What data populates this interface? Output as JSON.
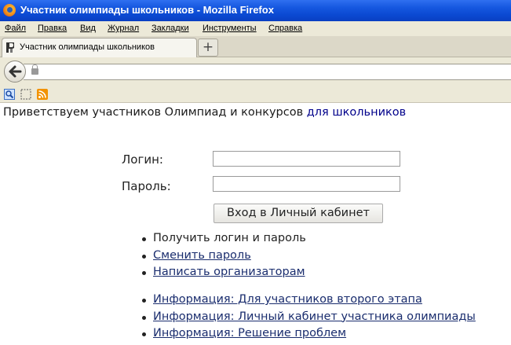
{
  "window": {
    "title": "Участник олимпиады школьников - Mozilla Firefox"
  },
  "menu": [
    {
      "label": "Файл"
    },
    {
      "label": "Правка"
    },
    {
      "label": "Вид"
    },
    {
      "label": "Журнал"
    },
    {
      "label": "Закладки"
    },
    {
      "label": "Инструменты"
    },
    {
      "label": "Справка"
    }
  ],
  "tab": {
    "label": "Участник олимпиады школьников",
    "new_tab_label": "+"
  },
  "page": {
    "welcome_text": "Приветствуем участников Олимпиад и конкурсов ",
    "welcome_link": "для школьников",
    "login_label": "Логин:",
    "password_label": "Пароль:",
    "login_value": "",
    "password_value": "",
    "submit_label": "Вход в Личный кабинет",
    "links_group1": [
      {
        "label": "Получить логин и пароль",
        "link": false
      },
      {
        "label": "Сменить пароль",
        "link": true
      },
      {
        "label": "Написать организаторам",
        "link": true
      }
    ],
    "links_group2": [
      {
        "label": "Информация: Для участников второго этапа",
        "link": true
      },
      {
        "label": "Информация: Личный кабинет участника олимпиады",
        "link": true
      },
      {
        "label": "Информация: Решение проблем",
        "link": true
      }
    ]
  },
  "icons": {
    "back": "back-arrow-icon",
    "lock": "lock-icon",
    "bookmarks": [
      "search-page-icon",
      "selection-icon",
      "rss-feed-icon"
    ]
  },
  "colors": {
    "titlebar": "#0b49d2",
    "chrome": "#ece9d8",
    "link": "#1a2d6e",
    "welcome_link": "#00008b"
  }
}
